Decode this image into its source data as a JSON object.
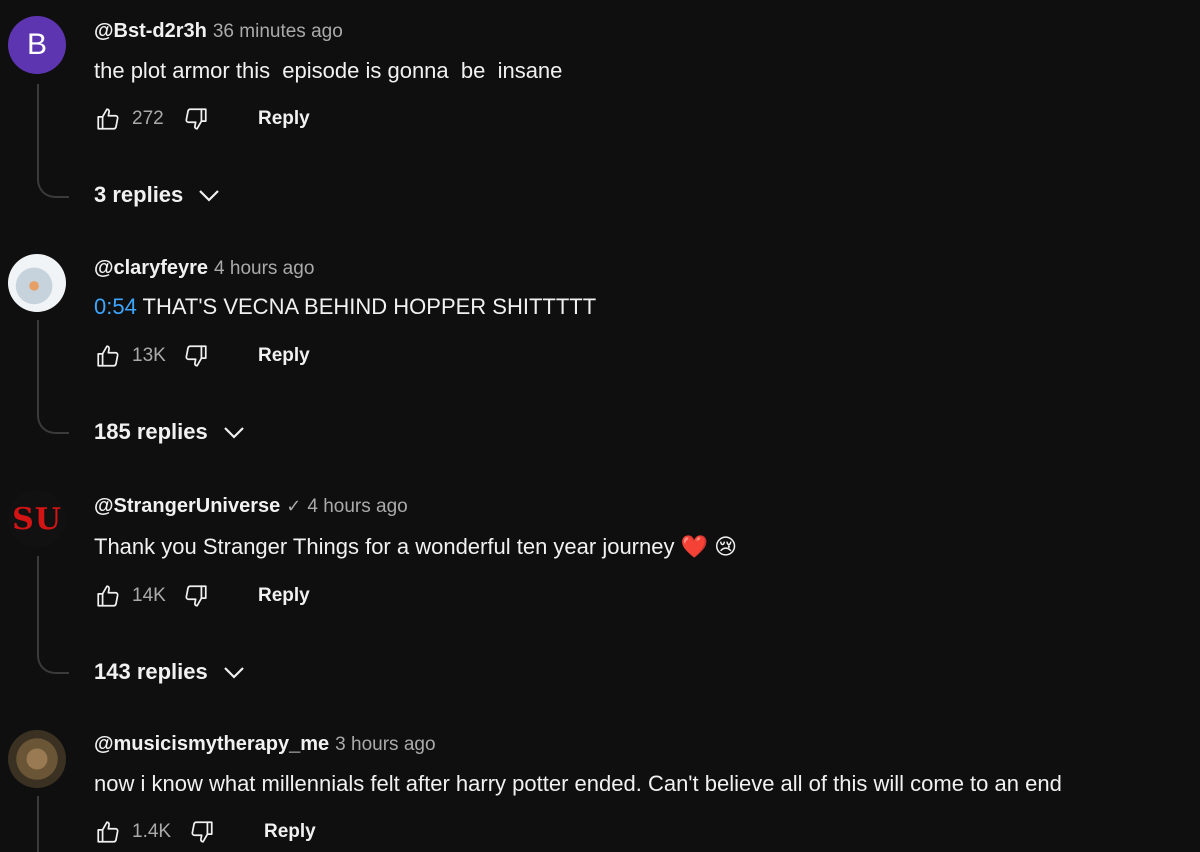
{
  "comments": [
    {
      "author": "@Bst-d2r3h",
      "time": "36 minutes ago",
      "text": "the plot armor this  episode is gonna  be  insane",
      "likes": "272",
      "reply_label": "Reply",
      "replies_label": "3 replies",
      "avatar_letter": "B"
    },
    {
      "author": "@claryfeyre",
      "time": "4 hours ago",
      "timestamp_link": "0:54",
      "text": " THAT'S VECNA BEHIND HOPPER SHITTTTT",
      "likes": "13K",
      "reply_label": "Reply",
      "replies_label": "185 replies"
    },
    {
      "author": "@StrangerUniverse",
      "verified_icon": "✓",
      "time": "4 hours ago",
      "text": "Thank you Stranger Things for a wonderful ten year journey ",
      "emoji1": "❤️",
      "emoji2": "😢",
      "likes": "14K",
      "reply_label": "Reply",
      "replies_label": "143 replies",
      "avatar_text": "SU"
    },
    {
      "author": "@musicismytherapy_me",
      "time": "3 hours ago",
      "text": "now i know what millennials felt after harry potter ended. Can't believe all of this will come to an end",
      "likes": "1.4K",
      "reply_label": "Reply"
    }
  ],
  "colors": {
    "background": "#0f0f0f",
    "text": "#f1f1f1",
    "secondary": "#aaaaaa",
    "link": "#3ea6ff",
    "avatar_b": "#5e35b1",
    "avatar_su": "#d31414"
  }
}
